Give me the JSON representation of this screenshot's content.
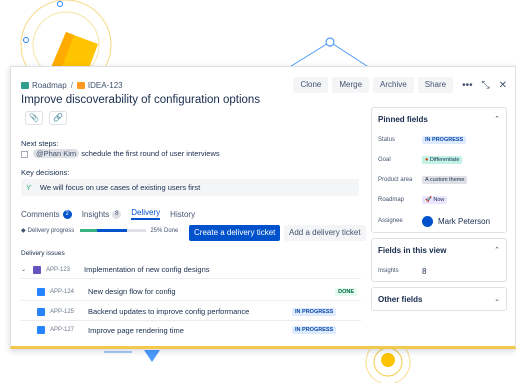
{
  "breadcrumb": {
    "project": "Roadmap",
    "issue": "IDEA-123"
  },
  "header_buttons": [
    "Clone",
    "Merge",
    "Archive",
    "Share"
  ],
  "title": "Improve discoverability of configuration options",
  "next_steps": {
    "label": "Next steps:",
    "mention": "@Phan Kim",
    "text": "schedule the first round of user interviews"
  },
  "key_decisions": {
    "label": "Key decisions:",
    "text": "We will focus on use cases of existing users first"
  },
  "tabs": [
    {
      "label": "Comments",
      "count": "2"
    },
    {
      "label": "Insights",
      "count": "8"
    },
    {
      "label": "Delivery",
      "count": ""
    },
    {
      "label": "History",
      "count": ""
    }
  ],
  "delivery": {
    "progress_label": "Delivery progress",
    "progress_done": 0.25,
    "progress_inprogress": 0.45,
    "percent_text": "25% Done",
    "create_label": "Create a delivery ticket",
    "add_label": "Add a delivery ticket",
    "issues_label": "Delivery issues",
    "issues": [
      {
        "key": "APP-123",
        "summary": "Implementation of new config designs",
        "status": "",
        "type": "epic"
      },
      {
        "key": "APP-124",
        "summary": "New design flow for config",
        "status": "DONE",
        "type": "task"
      },
      {
        "key": "APP-125",
        "summary": "Backend updates to improve config performance",
        "status": "IN PROGRESS",
        "type": "task"
      },
      {
        "key": "APP-127",
        "summary": "Improve page rendering time",
        "status": "IN PROGRESS",
        "type": "task"
      }
    ]
  },
  "pinned": {
    "title": "Pinned fields",
    "status": {
      "label": "Status",
      "value": "IN PROGRESS"
    },
    "goal": {
      "label": "Goal",
      "value": "Differentiate"
    },
    "product_area": {
      "label": "Product area",
      "value": "A custom theme"
    },
    "roadmap": {
      "label": "Roadmap",
      "value": "Now"
    },
    "assignee": {
      "label": "Assignee",
      "value": "Mark Peterson"
    }
  },
  "fields_in_view": {
    "title": "Fields in this view",
    "insights_label": "Insights",
    "insights_value": "8"
  },
  "other_fields": {
    "title": "Other fields"
  },
  "colors": {
    "primary": "#0052cc",
    "done": "#36b37e",
    "inprogress_bg": "#deebff",
    "done_bg": "#e3fcef"
  }
}
